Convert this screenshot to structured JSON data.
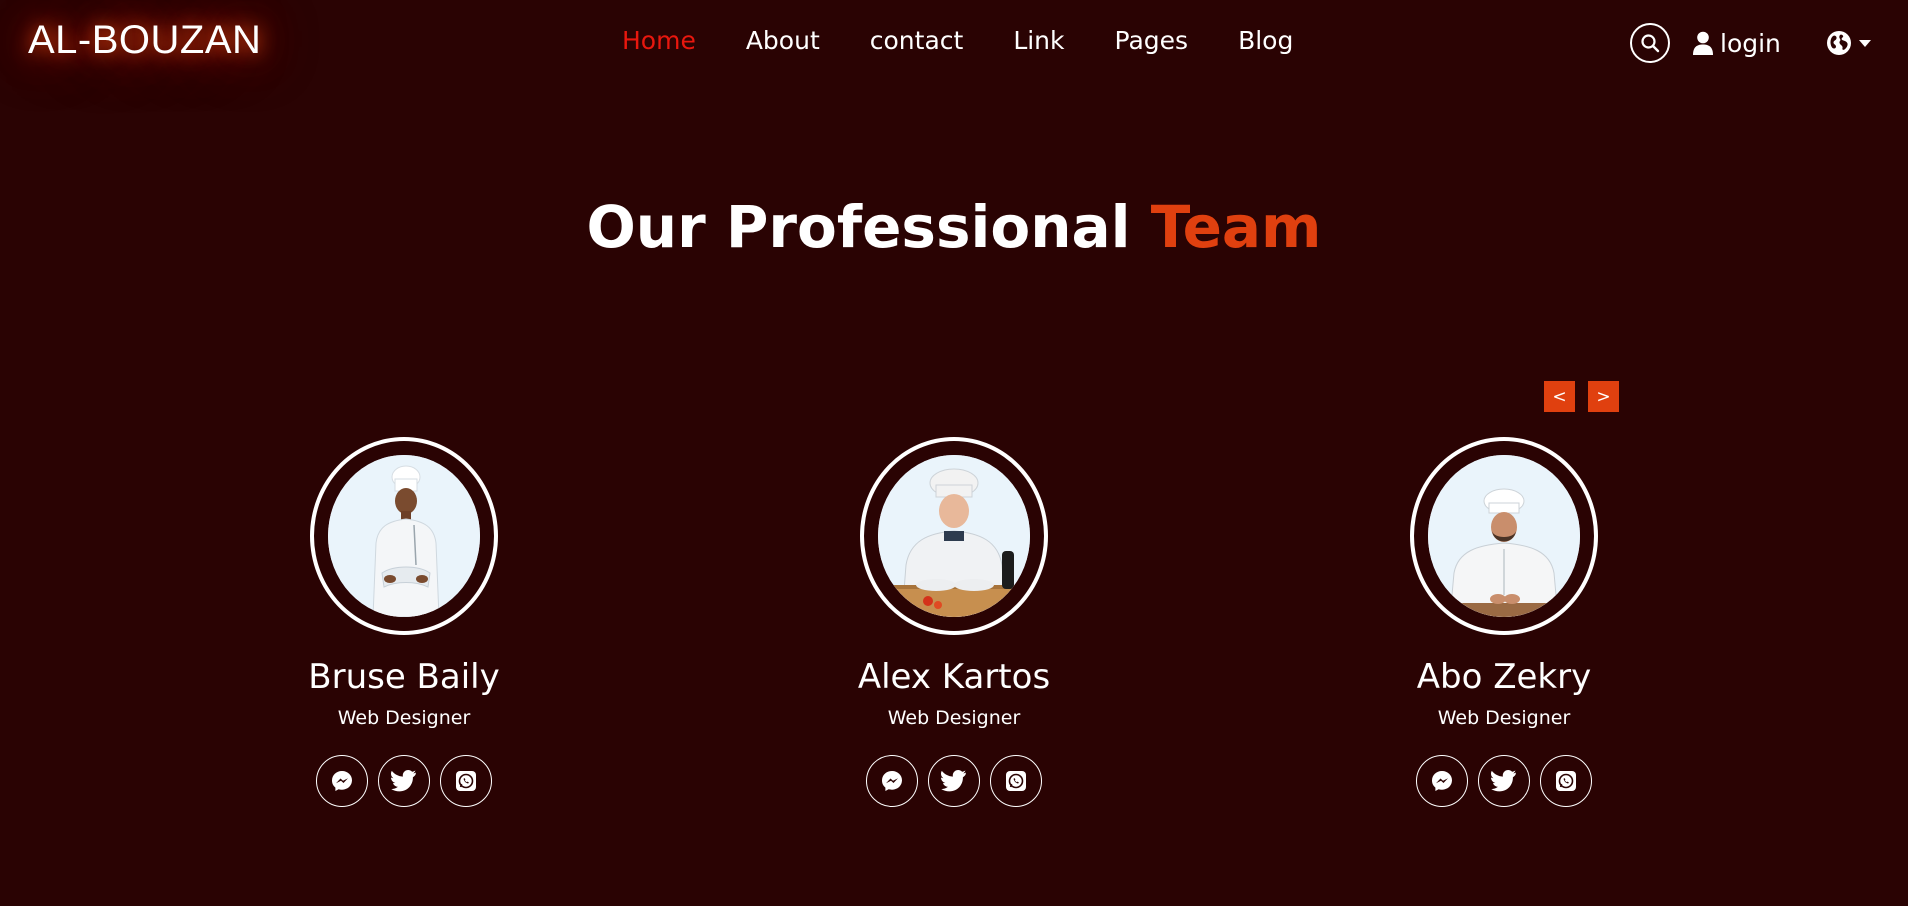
{
  "brand": "AL-BOUZAN",
  "nav": {
    "items": [
      {
        "label": "Home",
        "active": true
      },
      {
        "label": "About"
      },
      {
        "label": "contact"
      },
      {
        "label": "Link"
      },
      {
        "label": "Pages"
      },
      {
        "label": "Blog"
      }
    ],
    "login_label": "login"
  },
  "section": {
    "title_main": "Our Professional",
    "title_accent": "Team"
  },
  "carousel": {
    "prev_label": "<",
    "next_label": ">"
  },
  "team": [
    {
      "name": "Bruse Baily",
      "role": "Web Designer",
      "socials": [
        "messenger-icon",
        "twitter-icon",
        "whatsapp-icon"
      ]
    },
    {
      "name": "Alex Kartos",
      "role": "Web Designer",
      "socials": [
        "messenger-icon",
        "twitter-icon",
        "whatsapp-icon"
      ]
    },
    {
      "name": "Abo Zekry",
      "role": "Web Designer",
      "socials": [
        "messenger-icon",
        "twitter-icon",
        "whatsapp-icon"
      ]
    }
  ],
  "colors": {
    "background": "#2a0303",
    "accent": "#e0400f",
    "active_link": "#e8170e",
    "text": "#ffffff"
  }
}
